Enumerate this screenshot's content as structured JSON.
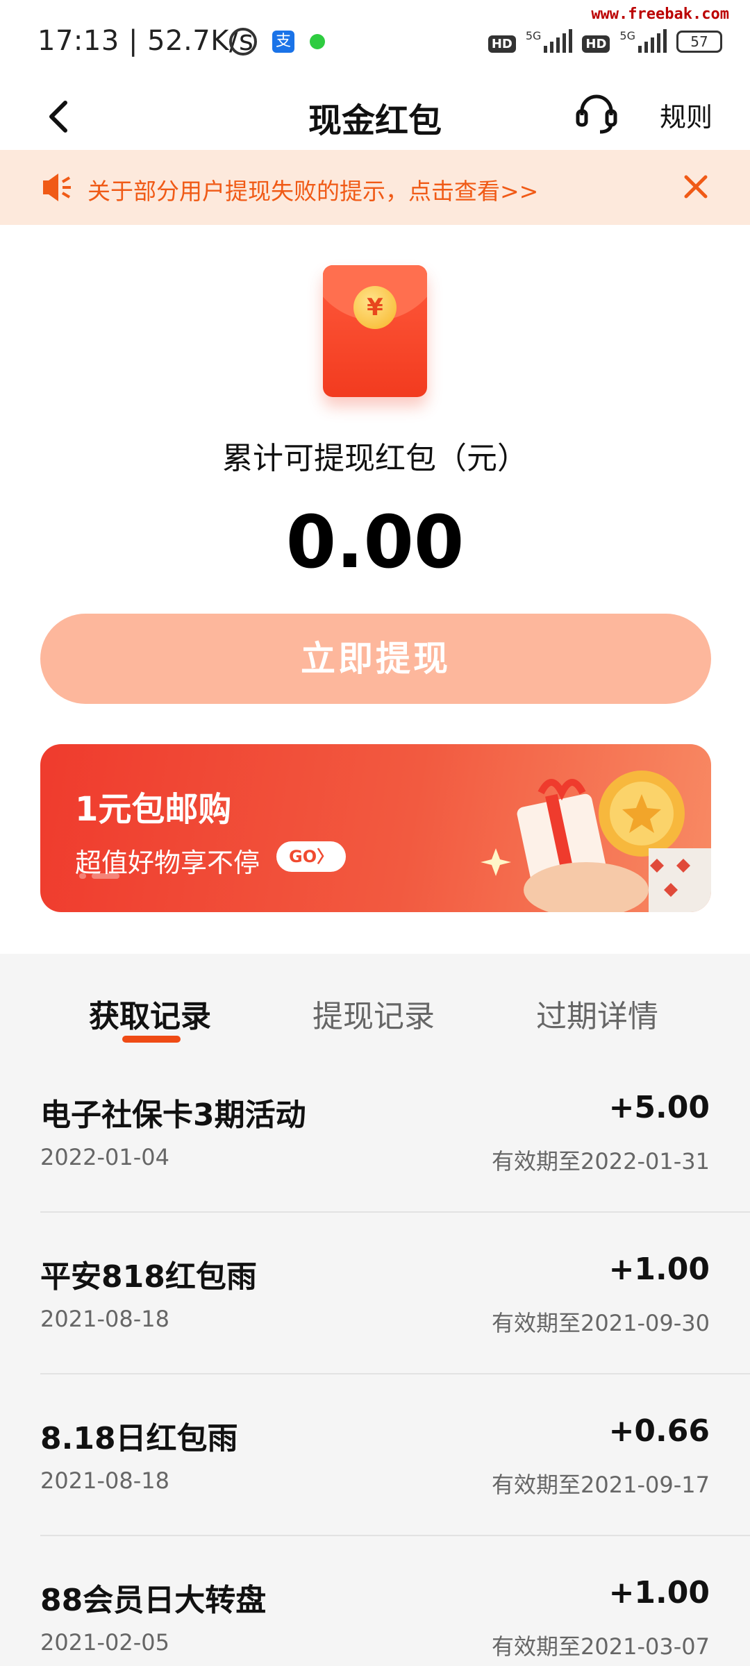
{
  "status_bar": {
    "time": "17:13 | 52.7K/s",
    "watermark": "www.freebak.com",
    "pay_icon_glyph": "支",
    "sim1_type": "5G",
    "sim2_type": "5G",
    "hd_label": "HD",
    "battery": "57"
  },
  "nav": {
    "title": "现金红包",
    "rules": "规则"
  },
  "notice": {
    "text": "关于部分用户提现失败的提示，点击查看>>",
    "accent_color": "#f05a16"
  },
  "balance": {
    "coin_glyph": "¥",
    "label": "累计可提现红包（元）",
    "amount": "0.00",
    "withdraw_button": "立即提现"
  },
  "banner": {
    "title": "1元包邮购",
    "subtitle": "超值好物享不停",
    "go_label": "GO〉"
  },
  "tabs": [
    {
      "label": "获取记录",
      "active": true
    },
    {
      "label": "提现记录",
      "active": false
    },
    {
      "label": "过期详情",
      "active": false
    }
  ],
  "records": [
    {
      "title": "电子社保卡3期活动",
      "date": "2022-01-04",
      "amount": "+5.00",
      "expiry": "有效期至2022-01-31"
    },
    {
      "title": "平安818红包雨",
      "date": "2021-08-18",
      "amount": "+1.00",
      "expiry": "有效期至2021-09-30"
    },
    {
      "title": "8.18日红包雨",
      "date": "2021-08-18",
      "amount": "+0.66",
      "expiry": "有效期至2021-09-17"
    },
    {
      "title": "88会员日大转盘",
      "date": "2021-02-05",
      "amount": "+1.00",
      "expiry": "有效期至2021-03-07"
    }
  ],
  "colors": {
    "brand_orange": "#ef4b15",
    "button_disabled": "#fdb79c",
    "notice_bg": "#fde9dc"
  }
}
